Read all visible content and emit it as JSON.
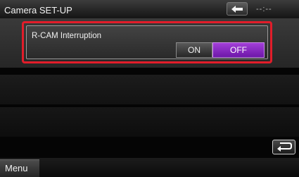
{
  "header": {
    "title": "Camera SET-UP",
    "clock": "--:--",
    "back_icon": "back-arrow-icon"
  },
  "setting": {
    "label": "R-CAM Interruption",
    "options": [
      "ON",
      "OFF"
    ],
    "selected": "OFF",
    "selected_color": "#8a2bc4",
    "highlight_color": "#e21d2a"
  },
  "footer": {
    "menu_label": "Menu",
    "return_icon": "return-icon"
  }
}
